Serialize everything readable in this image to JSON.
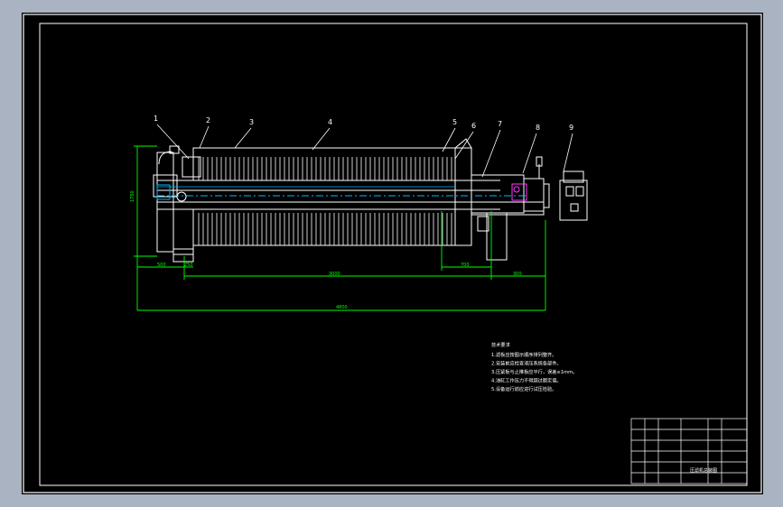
{
  "drawing": {
    "part_labels": [
      "1",
      "2",
      "3",
      "4",
      "5",
      "6",
      "7",
      "8",
      "9"
    ],
    "dimensions": {
      "height_left": "1750",
      "bottom_left_a": "500",
      "bottom_left_b": "250",
      "middle_span": "3000",
      "right_span_a": "700",
      "right_span_b": "300",
      "overall_length": "4800"
    },
    "notes_title": "技术要求",
    "notes": [
      "1.滤板应按图示顺序排列整齐。",
      "2.安装前应检查液压系统各部件。",
      "3.压紧板与止推板应平行，误差≤1mm。",
      "4.油缸工作压力不得超过额定值。",
      "5.设备运行前应进行试压检验。"
    ],
    "title_block_name": "压滤机总装图"
  },
  "colors": {
    "background_outer": "#a9b3c1",
    "drawing_area": "#000000",
    "frame_line": "#ffffff",
    "dimension_line": "#00ff00",
    "center_line": "#00b7ff",
    "hidden_line": "#ff3cff",
    "part_line": "#ffffff"
  }
}
